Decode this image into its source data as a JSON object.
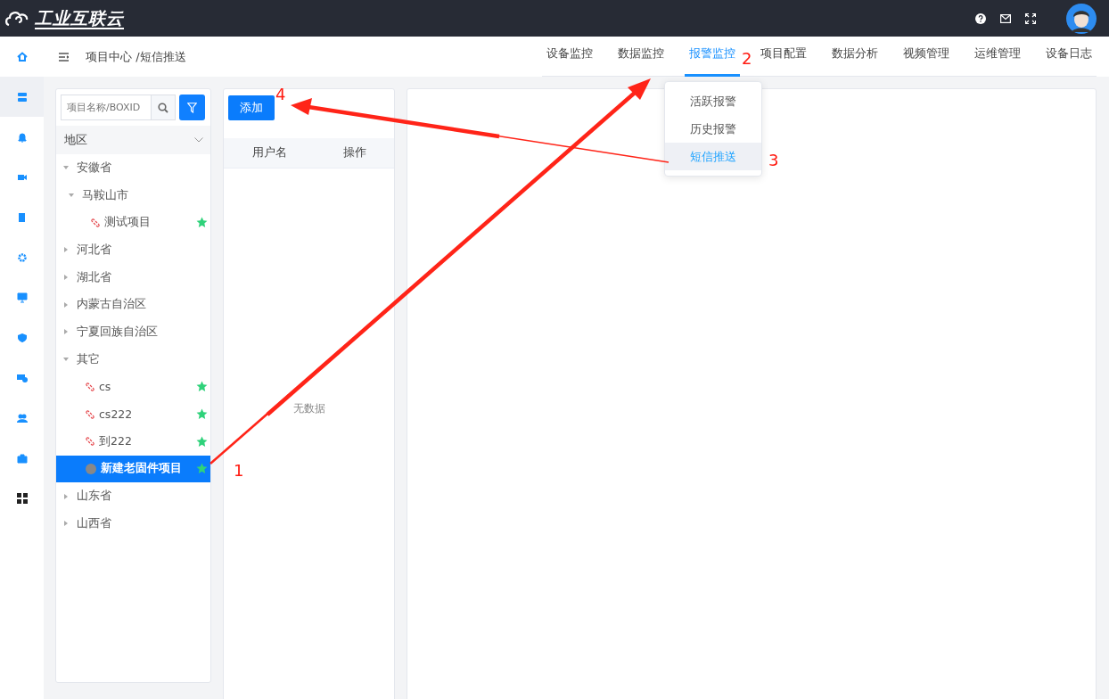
{
  "top_bar": {
    "logo": "工业互联云"
  },
  "side_nav": [
    {
      "selected": false
    },
    {
      "selected": true
    },
    {
      "selected": false
    },
    {
      "selected": false
    },
    {
      "selected": false
    },
    {
      "selected": false
    },
    {
      "selected": false
    },
    {
      "selected": false
    },
    {
      "selected": false
    },
    {
      "selected": false
    },
    {
      "selected": false
    },
    {
      "selected": false
    }
  ],
  "breadcrumb": "项目中心 /短信推送",
  "tabs": [
    {
      "label": "设备监控",
      "selected": false
    },
    {
      "label": "数据监控",
      "selected": false
    },
    {
      "label": "报警监控",
      "selected": true
    },
    {
      "label": "项目配置",
      "selected": false
    },
    {
      "label": "数据分析",
      "selected": false
    },
    {
      "label": "视频管理",
      "selected": false
    },
    {
      "label": "运维管理",
      "selected": false
    },
    {
      "label": "设备日志",
      "selected": false
    }
  ],
  "dropdown": [
    {
      "label": "活跃报警",
      "selected": false
    },
    {
      "label": "历史报警",
      "selected": false
    },
    {
      "label": "短信推送",
      "selected": true
    }
  ],
  "tree_panel": {
    "search": {
      "placeholder": "项目名称/BOXID"
    },
    "filter": "地区",
    "nodes": [
      {
        "label": "安徽省",
        "kind": "group",
        "expanded": true,
        "children": [
          {
            "label": "马鞍山市",
            "kind": "group",
            "expanded": true,
            "children": [
              {
                "label": "测试项目",
                "kind": "project",
                "starred": true,
                "selected": false
              }
            ]
          }
        ]
      },
      {
        "label": "河北省",
        "kind": "group",
        "expanded": false
      },
      {
        "label": "湖北省",
        "kind": "group",
        "expanded": false
      },
      {
        "label": "内蒙古自治区",
        "kind": "group",
        "expanded": false
      },
      {
        "label": "宁夏回族自治区",
        "kind": "group",
        "expanded": false
      },
      {
        "label": "其它",
        "kind": "group",
        "expanded": true,
        "children": [
          {
            "label": "cs",
            "kind": "project",
            "starred": true,
            "selected": false
          },
          {
            "label": "cs222",
            "kind": "project",
            "starred": true,
            "selected": false
          },
          {
            "label": "到222",
            "kind": "project",
            "starred": true,
            "selected": false
          },
          {
            "label": "新建老固件项目",
            "kind": "draft",
            "starred": true,
            "selected": true
          }
        ]
      },
      {
        "label": "山东省",
        "kind": "group",
        "expanded": false
      },
      {
        "label": "山西省",
        "kind": "group",
        "expanded": false
      }
    ]
  },
  "user_panel": {
    "add_button": "添加",
    "columns": [
      "用户名",
      "操作"
    ],
    "empty_text": "无数据"
  },
  "annotations": [
    {
      "label": "1"
    },
    {
      "label": "2"
    },
    {
      "label": "3"
    },
    {
      "label": "4"
    }
  ]
}
